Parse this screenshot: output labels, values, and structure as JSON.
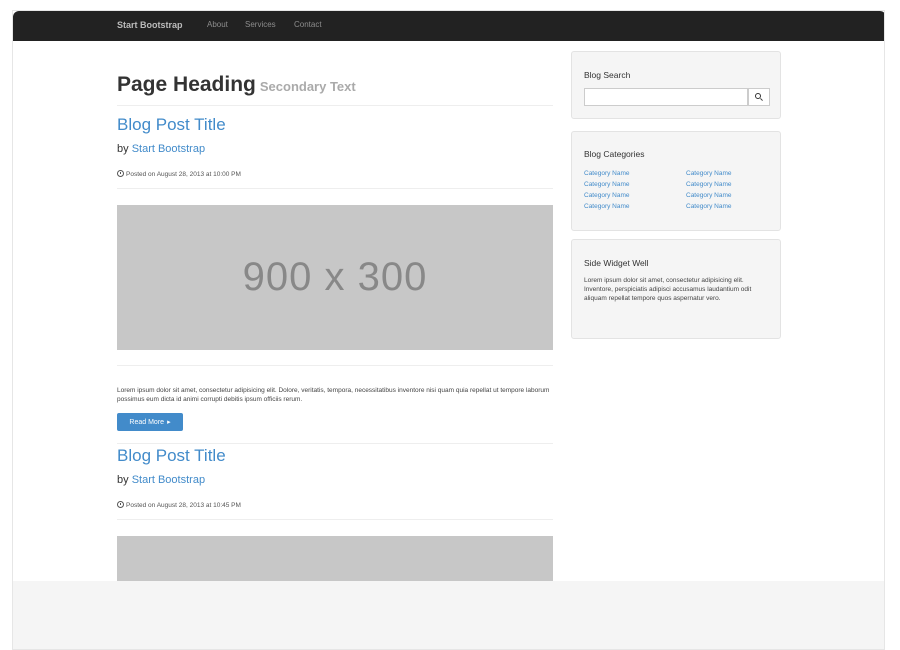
{
  "navbar": {
    "brand": "Start Bootstrap",
    "links": [
      "About",
      "Services",
      "Contact"
    ]
  },
  "main": {
    "heading": "Page Heading",
    "heading_secondary": "Secondary Text",
    "posts": [
      {
        "title": "Blog Post Title",
        "by": "by",
        "author": "Start Bootstrap",
        "posted": "Posted on August 28, 2013 at 10:00 PM",
        "image_label": "900 x 300",
        "excerpt": "Lorem ipsum dolor sit amet, consectetur adipisicing elit. Dolore, veritatis, tempora, necessitatibus inventore nisi quam quia repellat ut tempore laborum possimus eum dicta id animi corrupti debitis ipsum officiis rerum.",
        "read_more": "Read More"
      },
      {
        "title": "Blog Post Title",
        "by": "by",
        "author": "Start Bootstrap",
        "posted": "Posted on August 28, 2013 at 10:45 PM"
      }
    ]
  },
  "sidebar": {
    "search": {
      "title": "Blog Search",
      "placeholder": ""
    },
    "categories": {
      "title": "Blog Categories",
      "left": [
        "Category Name",
        "Category Name",
        "Category Name",
        "Category Name"
      ],
      "right": [
        "Category Name",
        "Category Name",
        "Category Name",
        "Category Name"
      ]
    },
    "widget": {
      "title": "Side Widget Well",
      "text": "Lorem ipsum dolor sit amet, consectetur adipisicing elit. Inventore, perspiciatis adipisci accusamus laudantium odit aliquam repellat tempore quos aspernatur vero."
    }
  },
  "colors": {
    "navbar_bg": "#222222",
    "link": "#428bca",
    "placeholder": "#c7c7c7",
    "well_bg": "#f5f5f5"
  },
  "icons": [
    "clock-icon",
    "search-icon",
    "chevron-right-icon"
  ]
}
